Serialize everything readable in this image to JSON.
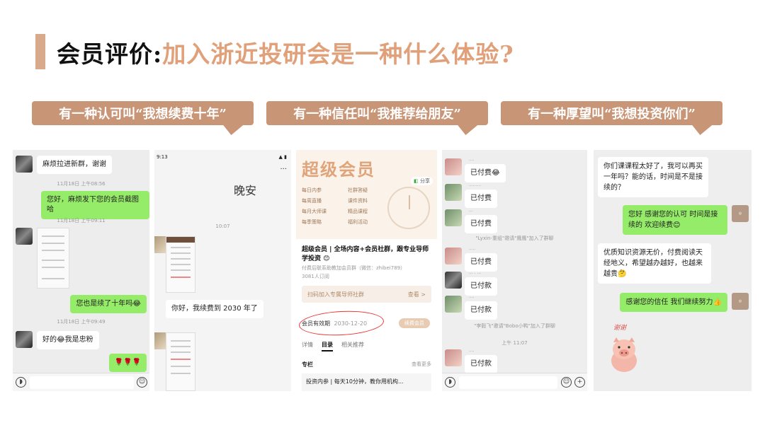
{
  "header": {
    "title_part1": "会员评价:",
    "title_part2": "加入浙近投研会是一种什么体验?"
  },
  "bubbles": [
    {
      "text": "有一种认可叫“我想续费十年”"
    },
    {
      "text": "有一种信任叫“我推荐给朋友”"
    },
    {
      "text": "有一种厚望叫“我想投资你们”"
    }
  ],
  "panel1": {
    "msg1": "麻烦拉进新群，谢谢",
    "time1": "11月18日 上午08:56",
    "msg2": "您好，麻烦发下您的会员截图哈",
    "time2": "11月18日 上午09:11",
    "msg3": "您也是续了十年吗😂",
    "time3": "11月18日 上午09:49",
    "msg4": "好的😂我是忠粉",
    "msg5": "🌹🌹🌹"
  },
  "panel2": {
    "status_time": "9:13",
    "greeting": "晚安",
    "time": "10:07",
    "msg": "你好，我续费到 2030 年了"
  },
  "panel3": {
    "vip_title": "超级会员",
    "share": "分享",
    "benefits": [
      "每日内参",
      "社群答疑",
      "每周直播",
      "课件资料",
      "每月大师课",
      "精品课程",
      "每季策略",
      "福利活动"
    ],
    "description": "超级会员 | 全场内容+会员社群，跟专业导师学投资 😊",
    "sub1": "付费后联系助教加会员群（微信：zhibei789）",
    "sub2": "3081人订阅",
    "scan": "扫码加入专属导师社群",
    "scan_action": "查看 >",
    "expiry_label": "会员有效期",
    "expiry_date": "2030-12-20",
    "renew": "续费会员",
    "tabs": [
      "详情",
      "目录",
      "相关推荐"
    ],
    "column_title": "专栏",
    "more": "查看更多",
    "course": "投资内参 | 每天10分钟，教你用机构..."
  },
  "panel4": {
    "msgs": [
      "已付费😂",
      "已付费",
      "已付费",
      "已付费",
      "已付款",
      "已付款",
      "已付款"
    ],
    "sys1": "\"Lyxin-重组\"邀请\"鹰鹰\"加入了群聊",
    "sys2": "\"李毅飞\"邀请\"Bobo小鸭\"加入了群聊",
    "time": "上午 11:07"
  },
  "panel5": {
    "msg1": "你们课课程太好了，我可以再买一年吗？能的话，时间是不是接续的？",
    "msg2": "您好 感谢您的认可 时间是接续的 欢迎续费😊",
    "msg3": "优质知识资源无价，付费阅读天经地义，希望越办越好，也越来越贵🤔",
    "msg4": "感谢您的信任 我们继续努力👍",
    "sticker_text": "谢谢"
  },
  "colors": {
    "accent": "#e0a07a",
    "bubble": "#c99577",
    "wechat_green": "#95ec69",
    "title_bar": "#d9a98b"
  }
}
